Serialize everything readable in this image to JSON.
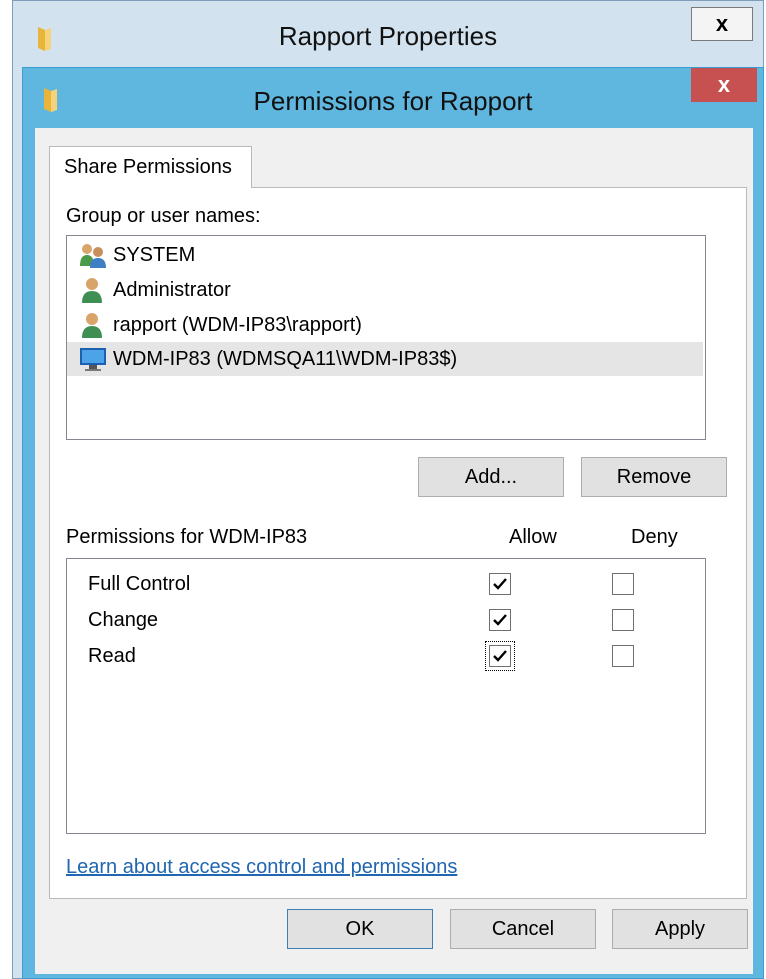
{
  "outer_window": {
    "title": "Rapport Properties",
    "close_label": "x"
  },
  "dialog": {
    "title": "Permissions for Rapport",
    "close_label": "x",
    "tab_label": "Share Permissions",
    "group_label": "Group or user names:",
    "users": [
      {
        "name": "SYSTEM",
        "icon": "users-group-icon",
        "selected": false
      },
      {
        "name": "Administrator",
        "icon": "user-icon",
        "selected": false
      },
      {
        "name": "rapport (WDM-IP83\\rapport)",
        "icon": "user-icon",
        "selected": false
      },
      {
        "name": "WDM-IP83 (WDMSQA11\\WDM-IP83$)",
        "icon": "computer-icon",
        "selected": true
      }
    ],
    "add_button": "Add...",
    "remove_button": "Remove",
    "permissions_label": "Permissions for WDM-IP83",
    "allow_header": "Allow",
    "deny_header": "Deny",
    "permissions": [
      {
        "name": "Full Control",
        "allow": true,
        "deny": false
      },
      {
        "name": "Change",
        "allow": true,
        "deny": false
      },
      {
        "name": "Read",
        "allow": true,
        "deny": false
      }
    ],
    "link_text": "Learn about access control and permissions",
    "ok_button": "OK",
    "cancel_button": "Cancel",
    "apply_button": "Apply"
  },
  "colors": {
    "dialog_frame": "#5fb7e0",
    "close_button": "#c75050",
    "link": "#2066b0",
    "selection": "#e5e5e5"
  }
}
